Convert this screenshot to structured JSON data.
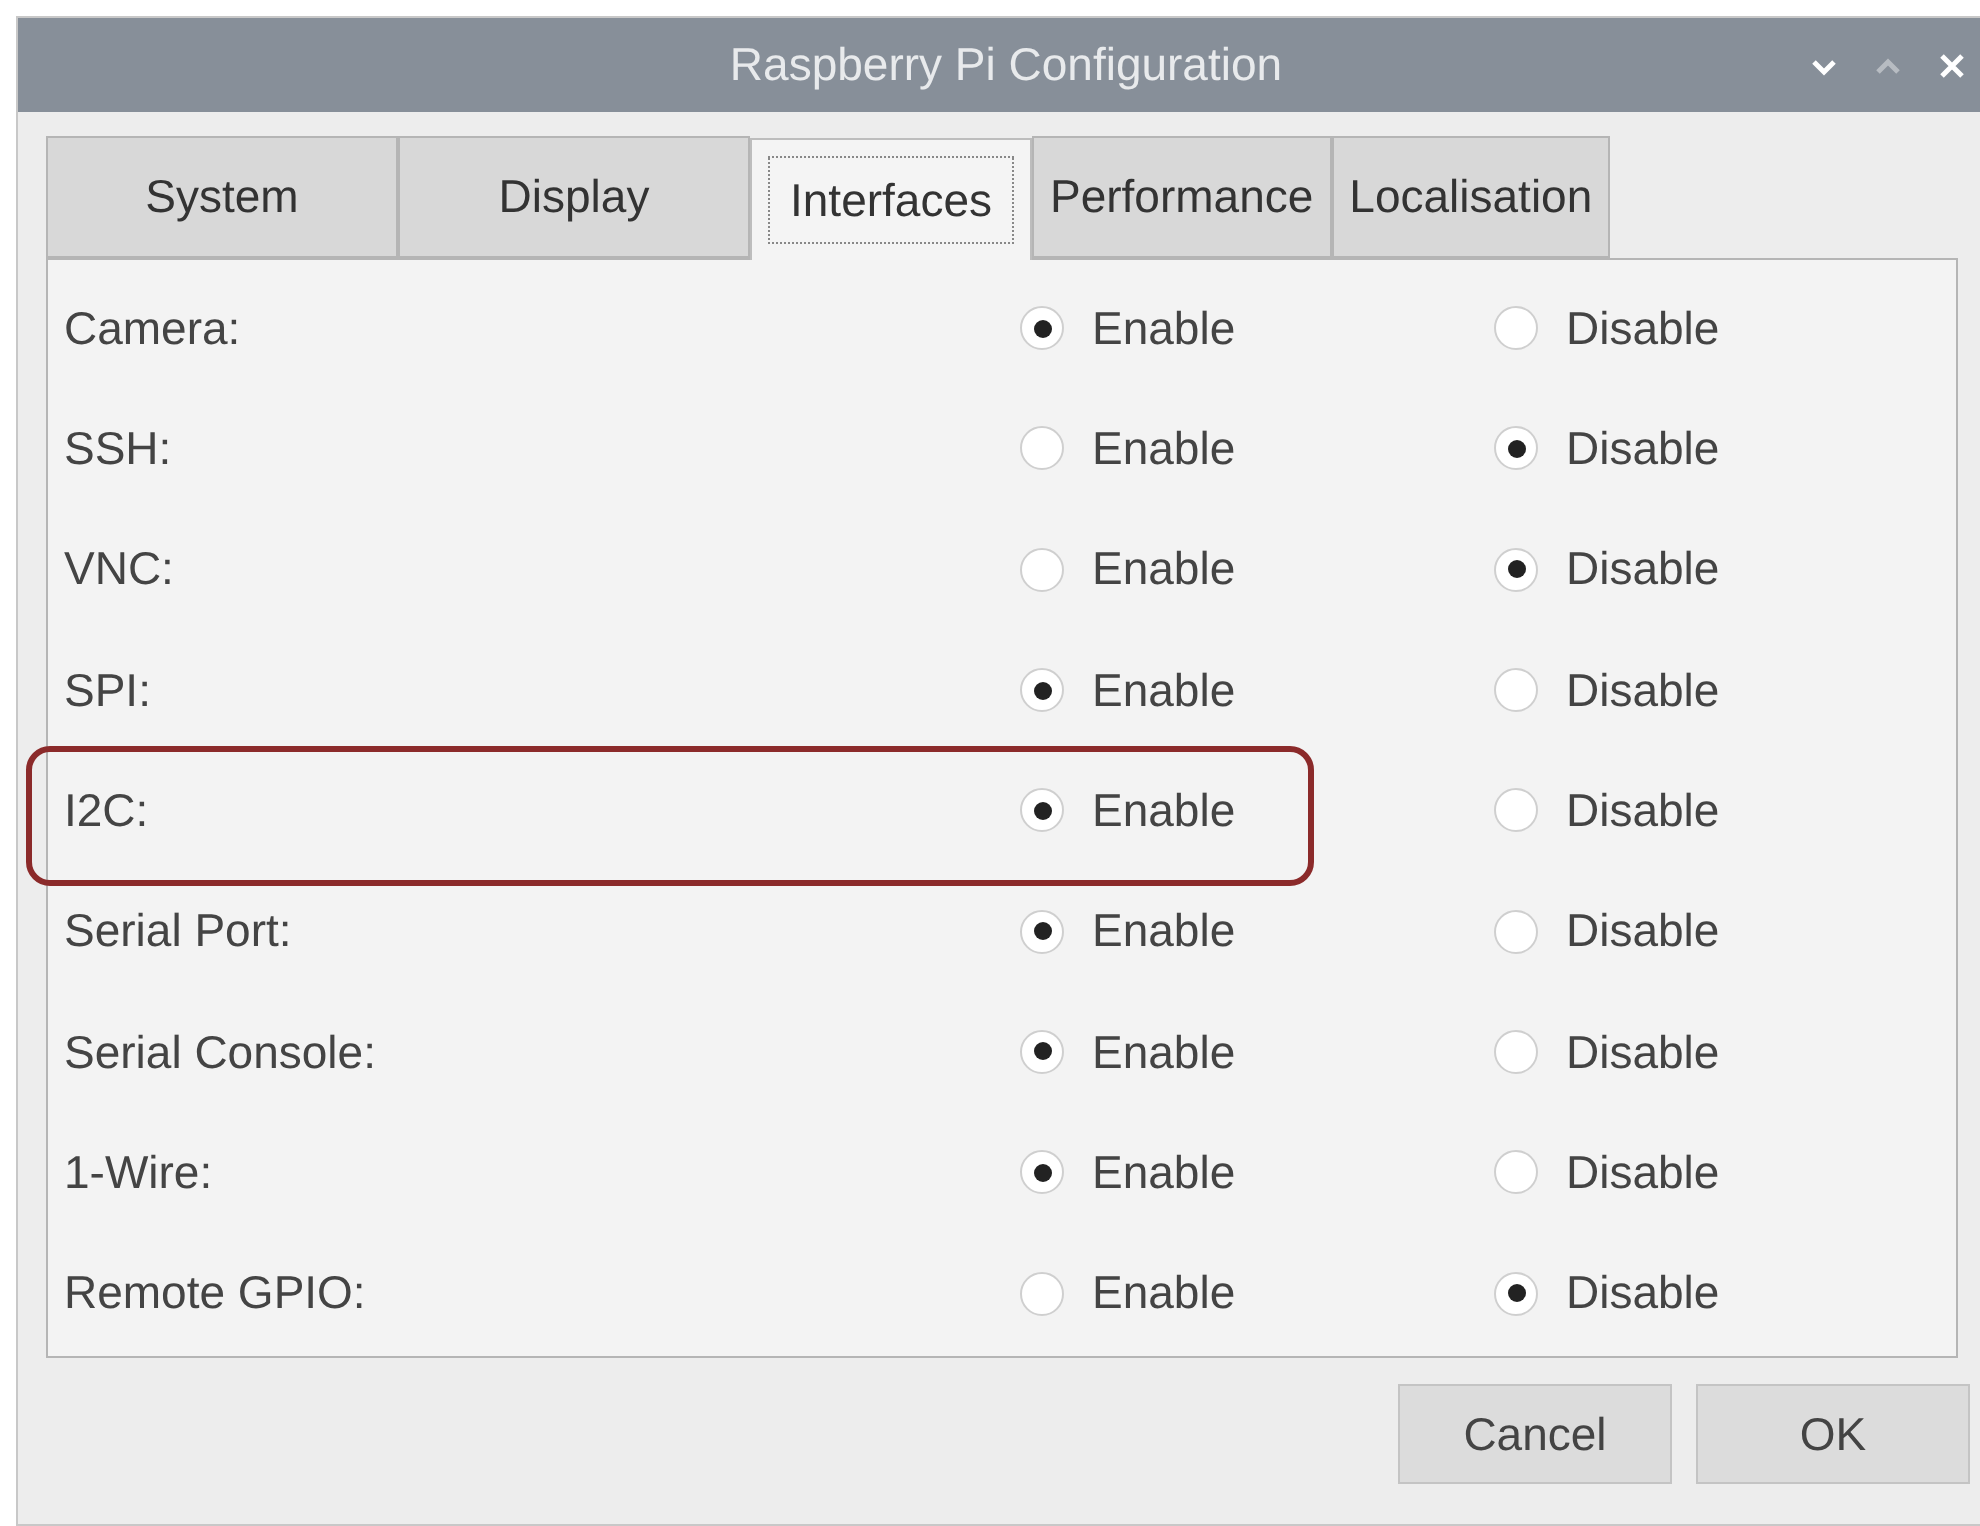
{
  "window": {
    "title": "Raspberry Pi Configuration"
  },
  "tabs": [
    {
      "label": "System",
      "selected": false
    },
    {
      "label": "Display",
      "selected": false
    },
    {
      "label": "Interfaces",
      "selected": true
    },
    {
      "label": "Performance",
      "selected": false
    },
    {
      "label": "Localisation",
      "selected": false
    }
  ],
  "rows": [
    {
      "label": "Camera:",
      "highlighted": false,
      "options": [
        {
          "label": "Enable",
          "selected": true
        },
        {
          "label": "Disable",
          "selected": false
        }
      ]
    },
    {
      "label": "SSH:",
      "highlighted": false,
      "options": [
        {
          "label": "Enable",
          "selected": false
        },
        {
          "label": "Disable",
          "selected": true
        }
      ]
    },
    {
      "label": "VNC:",
      "highlighted": false,
      "options": [
        {
          "label": "Enable",
          "selected": false
        },
        {
          "label": "Disable",
          "selected": true
        }
      ]
    },
    {
      "label": "SPI:",
      "highlighted": false,
      "options": [
        {
          "label": "Enable",
          "selected": true
        },
        {
          "label": "Disable",
          "selected": false
        }
      ]
    },
    {
      "label": "I2C:",
      "highlighted": true,
      "options": [
        {
          "label": "Enable",
          "selected": true
        },
        {
          "label": "Disable",
          "selected": false
        }
      ]
    },
    {
      "label": "Serial Port:",
      "highlighted": false,
      "options": [
        {
          "label": "Enable",
          "selected": true
        },
        {
          "label": "Disable",
          "selected": false
        }
      ]
    },
    {
      "label": "Serial Console:",
      "highlighted": false,
      "options": [
        {
          "label": "Enable",
          "selected": true
        },
        {
          "label": "Disable",
          "selected": false
        }
      ]
    },
    {
      "label": "1-Wire:",
      "highlighted": false,
      "options": [
        {
          "label": "Enable",
          "selected": true
        },
        {
          "label": "Disable",
          "selected": false
        }
      ]
    },
    {
      "label": "Remote GPIO:",
      "highlighted": false,
      "options": [
        {
          "label": "Enable",
          "selected": false
        },
        {
          "label": "Disable",
          "selected": true
        }
      ]
    }
  ],
  "buttons": [
    "Cancel",
    "OK"
  ]
}
